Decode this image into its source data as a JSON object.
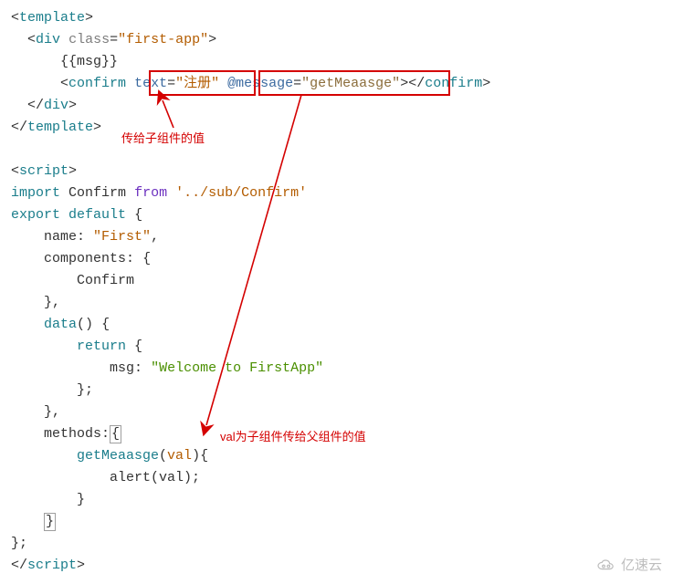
{
  "code": {
    "l1_open": "<",
    "l1_tag": "template",
    "l1_close": ">",
    "l2_open": "<",
    "l2_tag": "div",
    "l2_sp": " ",
    "l2_attr": "class",
    "l2_eq": "=",
    "l2_str": "\"first-app\"",
    "l2_close": ">",
    "l3_text": "{{msg}}",
    "l4_open": "<",
    "l4_tag": "confirm",
    "l4_sp": " ",
    "l4_attr1": "text",
    "l4_eq1": "=",
    "l4_str1": "\"注册\"",
    "l4_sp2": " ",
    "l4_attr2": "@message",
    "l4_eq2": "=",
    "l4_str2": "\"getMeaasge\"",
    "l4_close": ">",
    "l4_endopen": "</",
    "l4_endtag": "confirm",
    "l4_endclose": ">",
    "l5_open": "</",
    "l5_tag": "div",
    "l5_close": ">",
    "l6_open": "</",
    "l6_tag": "template",
    "l6_close": ">",
    "l8_open": "<",
    "l8_tag": "script",
    "l8_close": ">",
    "l9_import": "import",
    "l9_sp": " ",
    "l9_ident": "Confirm",
    "l9_sp2": " ",
    "l9_from": "from",
    "l9_sp3": " ",
    "l9_path": "'../sub/Confirm'",
    "l10_export": "export",
    "l10_sp": " ",
    "l10_default": "default",
    "l10_sp2": " ",
    "l10_brace": "{",
    "l11_name": "name:",
    "l11_sp": " ",
    "l11_val": "\"First\"",
    "l11_comma": ",",
    "l12_comp": "components:",
    "l12_sp": " ",
    "l12_brace": "{",
    "l13_conf": "Confirm",
    "l14_close": "},",
    "l15_data": "data",
    "l15_paren": "()",
    "l15_sp": " ",
    "l15_brace": "{",
    "l16_return": "return",
    "l16_sp": " ",
    "l16_brace": "{",
    "l17_msg": "msg:",
    "l17_sp": " ",
    "l17_val": "\"Welcome to FirstApp\"",
    "l18_close": "};",
    "l19_close": "},",
    "l20_methods": "methods:",
    "l20_brace": "{",
    "l21_fn": "getMeaasge",
    "l21_p1": "(",
    "l21_arg": "val",
    "l21_p2": ")",
    "l21_brace": "{",
    "l22_alert": "alert(val);",
    "l23_close": "}",
    "l24_close": "}",
    "l25_close": "};",
    "l26_open": "</",
    "l26_tag": "script",
    "l26_close": ">"
  },
  "annotations": {
    "annot1": "传给子组件的值",
    "annot2": "val为子组件传给父组件的值"
  },
  "watermark": {
    "text": "亿速云"
  }
}
